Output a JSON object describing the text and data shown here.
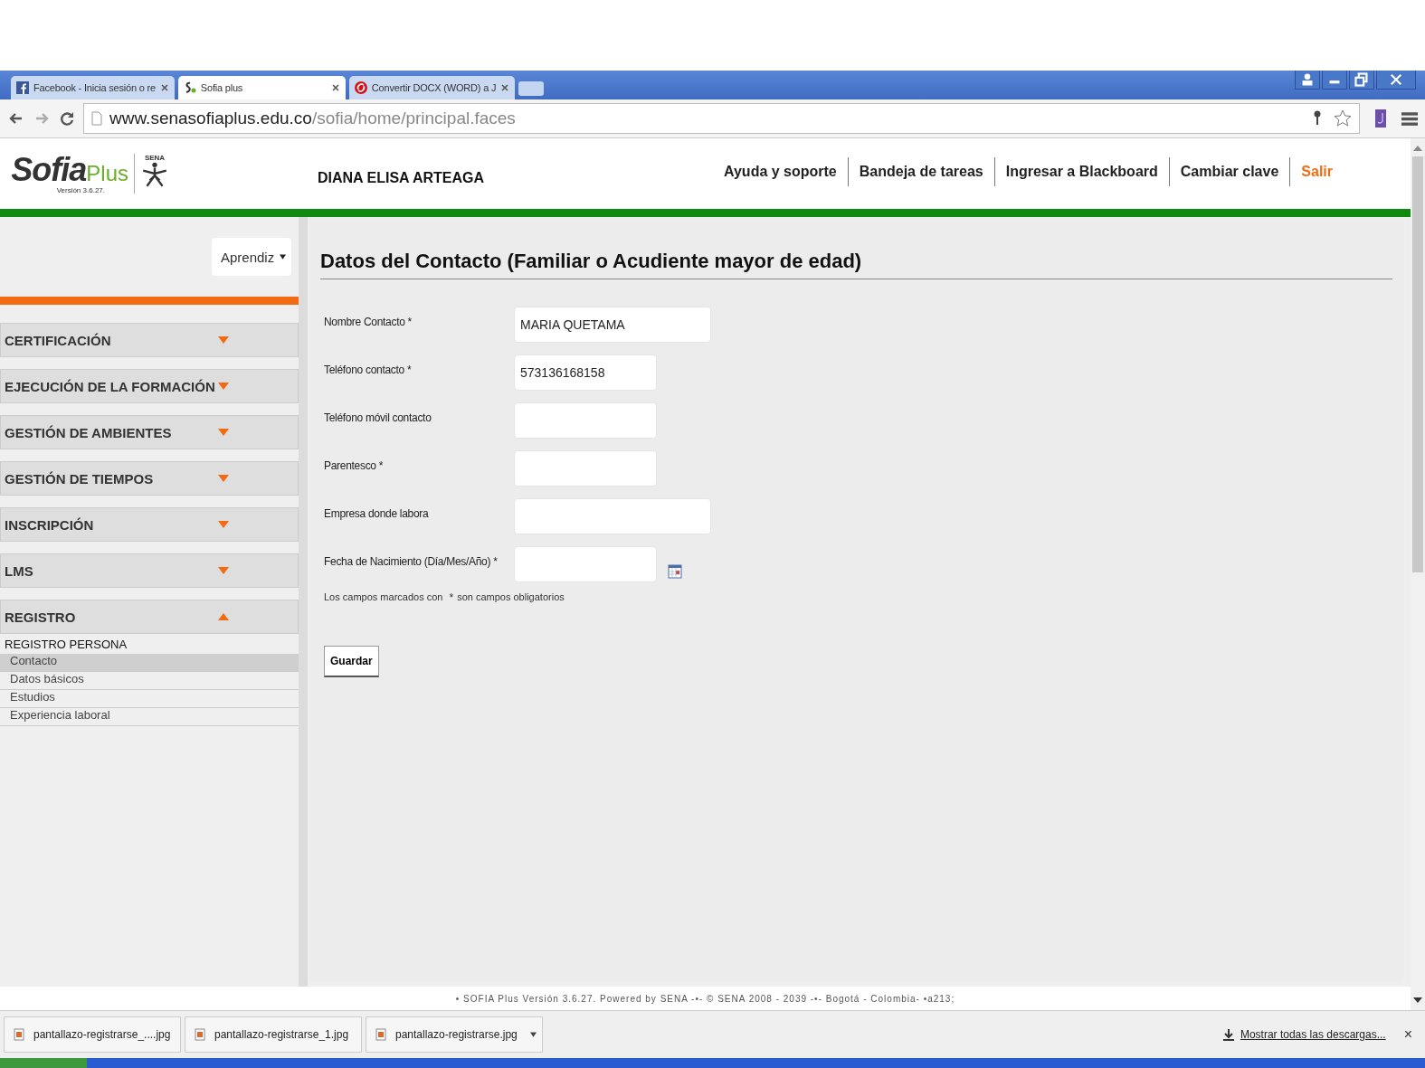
{
  "browser": {
    "tabs": [
      {
        "title": "Facebook - Inicia sesión o re",
        "kind": "facebook",
        "selected": false
      },
      {
        "title": "Sofia plus",
        "kind": "sofia",
        "selected": true
      },
      {
        "title": "Convertir DOCX (WORD) a J",
        "kind": "convert",
        "selected": false
      }
    ],
    "url_host": "www.senasofiaplus.edu.co",
    "url_path": "/sofia/home/principal.faces"
  },
  "header": {
    "logo": "Sofia",
    "logo_plus": "Plus",
    "version": "Versión 3.6.27.",
    "sena": "SENA",
    "user": "DIANA ELISA ARTEAGA",
    "links": [
      {
        "label": "Ayuda y soporte",
        "kind": "link"
      },
      {
        "label": "Bandeja de tareas",
        "kind": "link"
      },
      {
        "label": "Ingresar a Blackboard",
        "kind": "link"
      },
      {
        "label": "Cambiar clave",
        "kind": "link"
      },
      {
        "label": "Salir",
        "kind": "exit"
      }
    ]
  },
  "sidebar": {
    "role": "Aprendiz",
    "menu": [
      {
        "label": "CERTIFICACIÓN",
        "expanded": false
      },
      {
        "label": "EJECUCIÓN DE LA FORMACIÓN",
        "expanded": false
      },
      {
        "label": "GESTIÓN DE AMBIENTES",
        "expanded": false
      },
      {
        "label": "GESTIÓN DE TIEMPOS",
        "expanded": false
      },
      {
        "label": "INSCRIPCIÓN",
        "expanded": false
      },
      {
        "label": "LMS",
        "expanded": false
      },
      {
        "label": "REGISTRO",
        "expanded": true
      }
    ],
    "submenu": {
      "title": "REGISTRO PERSONA",
      "items": [
        {
          "label": "Contacto",
          "selected": true
        },
        {
          "label": "Datos básicos",
          "selected": false
        },
        {
          "label": "Estudios",
          "selected": false
        },
        {
          "label": "Experiencia laboral",
          "selected": false
        }
      ]
    }
  },
  "form": {
    "title": "Datos del Contacto (Familiar o Acudiente mayor de edad)",
    "required_mark": "*",
    "fields": [
      {
        "label": "Nombre Contacto",
        "required": true,
        "value": "MARIA QUETAMA",
        "wide": true,
        "kind": "text"
      },
      {
        "label": "Teléfono contacto",
        "required": true,
        "value": "573136168158",
        "wide": false,
        "kind": "text"
      },
      {
        "label": "Teléfono móvil contacto",
        "required": false,
        "wide": false,
        "kind": "text"
      },
      {
        "label": "Parentesco",
        "required": true,
        "wide": false,
        "kind": "text"
      },
      {
        "label": "Empresa donde labora",
        "required": false,
        "wide": true,
        "kind": "text"
      },
      {
        "label": "Fecha de Nacimiento (Día/Mes/Año)",
        "required": true,
        "wide": false,
        "kind": "date"
      }
    ],
    "note_before": "Los campos marcados con",
    "note_after": "son campos obligatorios",
    "button": "Guardar"
  },
  "footer": "• SOFIA Plus Versión 3.6.27. Powered by SENA -•- © SENA 2008 - 2039 -•- Bogotá - Colombia- •a213;",
  "downloads": {
    "files": [
      {
        "name": "pantallazo-registrarse_....jpg"
      },
      {
        "name": "pantallazo-registrarse_1.jpg"
      },
      {
        "name": "pantallazo-registrarse.jpg"
      }
    ],
    "show_all": "Mostrar todas las descargas...",
    "close": "×"
  }
}
